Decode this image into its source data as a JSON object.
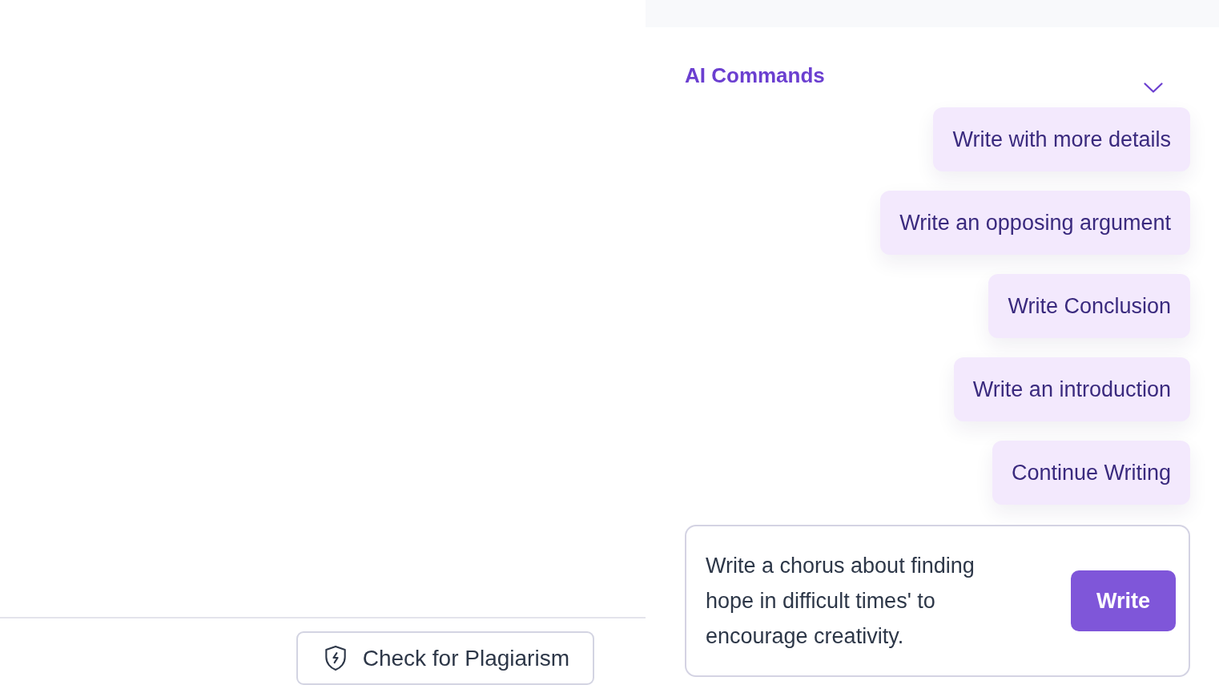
{
  "plagiarism_button": {
    "label": "Check for Plagiarism"
  },
  "ai_commands": {
    "title": "AI Commands",
    "commands": [
      "Write with more details",
      "Write an opposing argument",
      "Write Conclusion",
      "Write an introduction",
      "Continue Writing"
    ]
  },
  "prompt": {
    "value": "Write a chorus about finding hope in difficult times' to encourage creativity.",
    "button": "Write"
  }
}
